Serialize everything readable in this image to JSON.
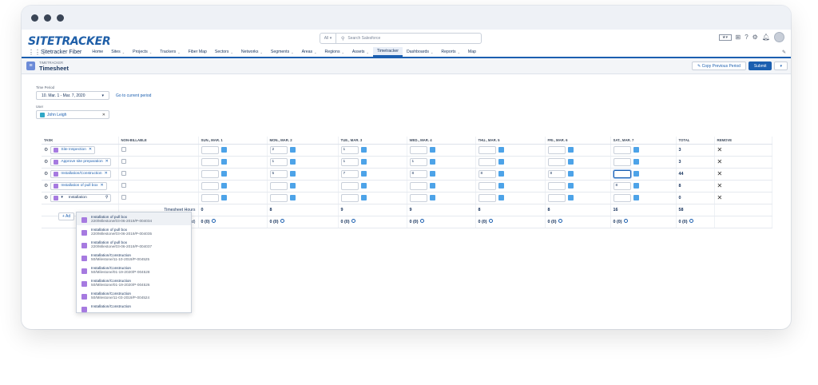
{
  "topbar": {
    "logo": "SITETRACKER",
    "search_scope": "All",
    "search_placeholder": "Search Salesforce"
  },
  "nav": {
    "app_name": "Sitetracker Fiber",
    "items": [
      {
        "label": "Home",
        "chev": false
      },
      {
        "label": "Sites",
        "chev": true
      },
      {
        "label": "Projects",
        "chev": true
      },
      {
        "label": "Trackers",
        "chev": true
      },
      {
        "label": "Fiber Map",
        "chev": false
      },
      {
        "label": "Sectors",
        "chev": true
      },
      {
        "label": "Networks",
        "chev": true
      },
      {
        "label": "Segments",
        "chev": true
      },
      {
        "label": "Areas",
        "chev": true
      },
      {
        "label": "Regions",
        "chev": true
      },
      {
        "label": "Assets",
        "chev": true
      },
      {
        "label": "Timetracker",
        "chev": false,
        "active": true
      },
      {
        "label": "Dashboards",
        "chev": true
      },
      {
        "label": "Reports",
        "chev": true
      },
      {
        "label": "Map",
        "chev": false
      }
    ]
  },
  "page": {
    "crumb": "TIMETRACKER",
    "title": "Timesheet",
    "copy_btn": "Copy Previous Period",
    "submit_btn": "Submit"
  },
  "filters": {
    "time_period_label": "Time Period",
    "time_period_value": "10. Mar. 1 - Mar. 7, 2020",
    "go_current": "Go to current period",
    "user_label": "User",
    "user_value": "John Leigh"
  },
  "table": {
    "headers": [
      "TASK",
      "NON-BILLABLE",
      "SUN., MAR. 1",
      "MON., MAR. 2",
      "TUE., MAR. 3",
      "WED., MAR. 4",
      "THU., MAR. 5",
      "FRI., MAR. 6",
      "SAT., MAR. 7",
      "TOTAL",
      "REMOVE"
    ],
    "rows": [
      {
        "task": "Site Inspection",
        "values": [
          "",
          "2",
          "1",
          "",
          "",
          "",
          ""
        ],
        "total": "3"
      },
      {
        "task": "Approve site preparation",
        "values": [
          "",
          "1",
          "1",
          "1",
          "",
          "",
          ""
        ],
        "total": "3"
      },
      {
        "task": "Installation/Construction",
        "values": [
          "",
          "5",
          "7",
          "8",
          "8",
          "8",
          ""
        ],
        "total": "44"
      },
      {
        "task": "Installation of pull box",
        "values": [
          "",
          "",
          "",
          "",
          "",
          "",
          "8"
        ],
        "total": "8"
      },
      {
        "task": "Installation",
        "values": [
          "",
          "",
          "",
          "",
          "",
          "",
          ""
        ],
        "total": "0"
      }
    ],
    "timesheet_hours_label": "Timesheet Hours",
    "timesheet_hours": [
      "0",
      "8",
      "9",
      "9",
      "8",
      "8",
      "16",
      "58"
    ],
    "total_worked_label": "Total (Worked)",
    "total_worked": [
      "0 (0)",
      "0 (0)",
      "0 (0)",
      "0 (0)",
      "0 (0)",
      "0 (0)",
      "0 (0)",
      "0 (0)"
    ],
    "add_label": "+ Ad"
  },
  "dropdown": [
    {
      "title": "Installation of pull box",
      "sub": "220/Milestone/03-06-2019/P-004034"
    },
    {
      "title": "Installation of pull box",
      "sub": "220/Milestone/03-06-2019/P-004035"
    },
    {
      "title": "Installation of pull box",
      "sub": "220/Milestone/03-06-2019/P-004037"
    },
    {
      "title": "Installation/Construction",
      "sub": "50/Milestone/11-10-2019/P-004525"
    },
    {
      "title": "Installation/Construction",
      "sub": "50/Milestone/01-19-2020/P-004528"
    },
    {
      "title": "Installation/Construction",
      "sub": "50/Milestone/01-19-2020/P-004526"
    },
    {
      "title": "Installation/Construction",
      "sub": "50/Milestone/11-03-2019/P-004524"
    },
    {
      "title": "Installation/Construction",
      "sub": ""
    }
  ]
}
